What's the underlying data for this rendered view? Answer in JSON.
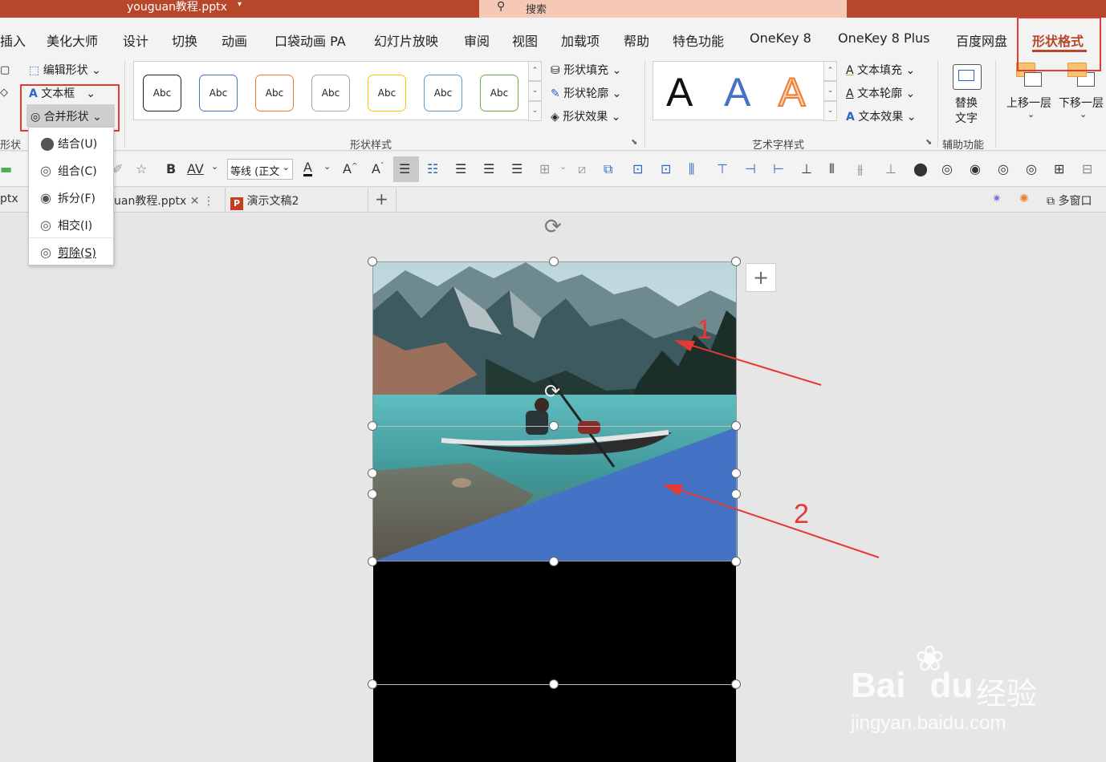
{
  "window": {
    "title": "youguan教程.pptx",
    "title_arrow": "▾",
    "search_placeholder": "搜索"
  },
  "menu": {
    "tabs": [
      "插入",
      "美化大师",
      "设计",
      "切换",
      "动画",
      "口袋动画 PA",
      "幻灯片放映",
      "审阅",
      "视图",
      "加载项",
      "帮助",
      "特色功能",
      "OneKey 8",
      "OneKey 8 Plus",
      "百度网盘"
    ],
    "active_tab": "形状格式"
  },
  "ribbon": {
    "insert_group": {
      "edit_shape": "编辑形状",
      "text_box": "文本框",
      "merge_shapes": "合并形状",
      "label": "形状"
    },
    "shape_styles": {
      "swatch_label": "Abc",
      "swatches": [
        "#222222",
        "#4472c4",
        "#ed7d31",
        "#a5a5a5",
        "#ffc000",
        "#5b9bd5",
        "#70ad47"
      ],
      "fill": "形状填充",
      "outline": "形状轮廓",
      "effects": "形状效果",
      "label": "形状样式"
    },
    "wordart": {
      "glyph": "A",
      "text_fill": "文本填充",
      "text_outline": "文本轮廓",
      "text_effects": "文本效果",
      "label": "艺术字样式"
    },
    "accessibility": {
      "alt_text_1": "替换",
      "alt_text_2": "文字",
      "label": "辅助功能"
    },
    "arrange": {
      "bring_forward": "上移一层",
      "send_backward": "下移一层"
    }
  },
  "toolbar2": {
    "bold": "B",
    "char_spacing": "AV",
    "font_name": "等线 (正文",
    "font_color": "A",
    "grow": "A",
    "shrink": "A"
  },
  "doc_tabs": {
    "tab1_partial": "ptx",
    "tab2": "uan教程.pptx",
    "tab3": "演示文稿2",
    "add": "+",
    "multiwindow": "多窗口"
  },
  "merge_menu": {
    "items": [
      {
        "label": "结合(U)"
      },
      {
        "label": "组合(C)"
      },
      {
        "label": "拆分(F)"
      },
      {
        "label": "相交(I)"
      },
      {
        "label": "剪除(S)"
      }
    ]
  },
  "annotations": {
    "label1": "1",
    "label2": "2"
  },
  "watermark": {
    "brand": "Bai",
    "brand2": "du",
    "cn": "经验",
    "url": "jingyan.baidu.com"
  },
  "colors": {
    "accent": "#b7472a",
    "highlight": "#e53935",
    "shape_blue": "#4472c4"
  }
}
